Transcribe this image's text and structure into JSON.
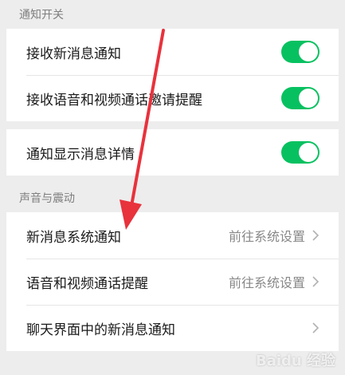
{
  "sections": [
    {
      "header": "通知开关",
      "rows": [
        {
          "label": "接收新消息通知",
          "toggle_on": true
        },
        {
          "label": "接收语音和视频通话邀请提醒",
          "toggle_on": true
        }
      ]
    },
    {
      "header": "",
      "rows": [
        {
          "label": "通知显示消息详情",
          "toggle_on": true
        }
      ]
    },
    {
      "header": "声音与震动",
      "rows": [
        {
          "label": "新消息系统通知",
          "value": "前往系统设置"
        },
        {
          "label": "语音和视频通话提醒",
          "value": "前往系统设置"
        },
        {
          "label": "聊天界面中的新消息通知",
          "value": ""
        }
      ]
    }
  ],
  "watermark": "Baidu 经验",
  "colors": {
    "toggle_on": "#07c160",
    "annotation_arrow": "#e8323c"
  }
}
